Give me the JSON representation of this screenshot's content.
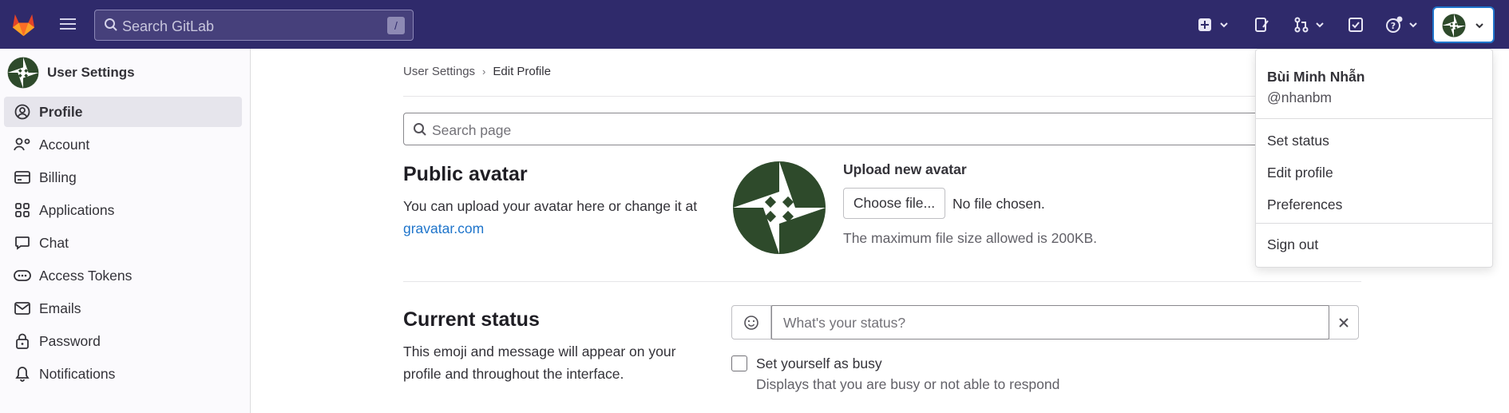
{
  "topbar": {
    "search_placeholder": "Search GitLab",
    "search_shortcut": "/",
    "icons": [
      "gitlab-logo",
      "hamburger-menu",
      "create-new",
      "issues",
      "merge-requests",
      "todos",
      "help",
      "user-avatar"
    ],
    "background": "#2f2a6b"
  },
  "sidebar": {
    "title": "User Settings",
    "items": [
      {
        "label": "Profile",
        "icon": "profile",
        "active": true
      },
      {
        "label": "Account",
        "icon": "account"
      },
      {
        "label": "Billing",
        "icon": "billing"
      },
      {
        "label": "Applications",
        "icon": "applications"
      },
      {
        "label": "Chat",
        "icon": "chat"
      },
      {
        "label": "Access Tokens",
        "icon": "token"
      },
      {
        "label": "Emails",
        "icon": "mail"
      },
      {
        "label": "Password",
        "icon": "lock"
      },
      {
        "label": "Notifications",
        "icon": "bell"
      }
    ]
  },
  "breadcrumb": {
    "parent": "User Settings",
    "separator": "›",
    "current": "Edit Profile"
  },
  "search_page": {
    "placeholder": "Search page"
  },
  "public_avatar": {
    "title": "Public avatar",
    "description": "You can upload your avatar here or change it at",
    "link_text": "gravatar.com",
    "upload_title": "Upload new avatar",
    "choose_button": "Choose file...",
    "no_file": "No file chosen.",
    "max_size": "The maximum file size allowed is 200KB."
  },
  "current_status": {
    "title": "Current status",
    "description": "This emoji and message will appear on your profile and throughout the interface.",
    "placeholder": "What's your status?",
    "busy_label": "Set yourself as busy",
    "busy_help": "Displays that you are busy or not able to respond"
  },
  "user_menu": {
    "name": "Bùi Minh Nhẫn",
    "username": "@nhanbm",
    "items": [
      "Set status",
      "Edit profile",
      "Preferences"
    ],
    "sign_out": "Sign out"
  },
  "colors": {
    "accent": "#1f75cb",
    "avatar_green": "#2e4a2b"
  }
}
